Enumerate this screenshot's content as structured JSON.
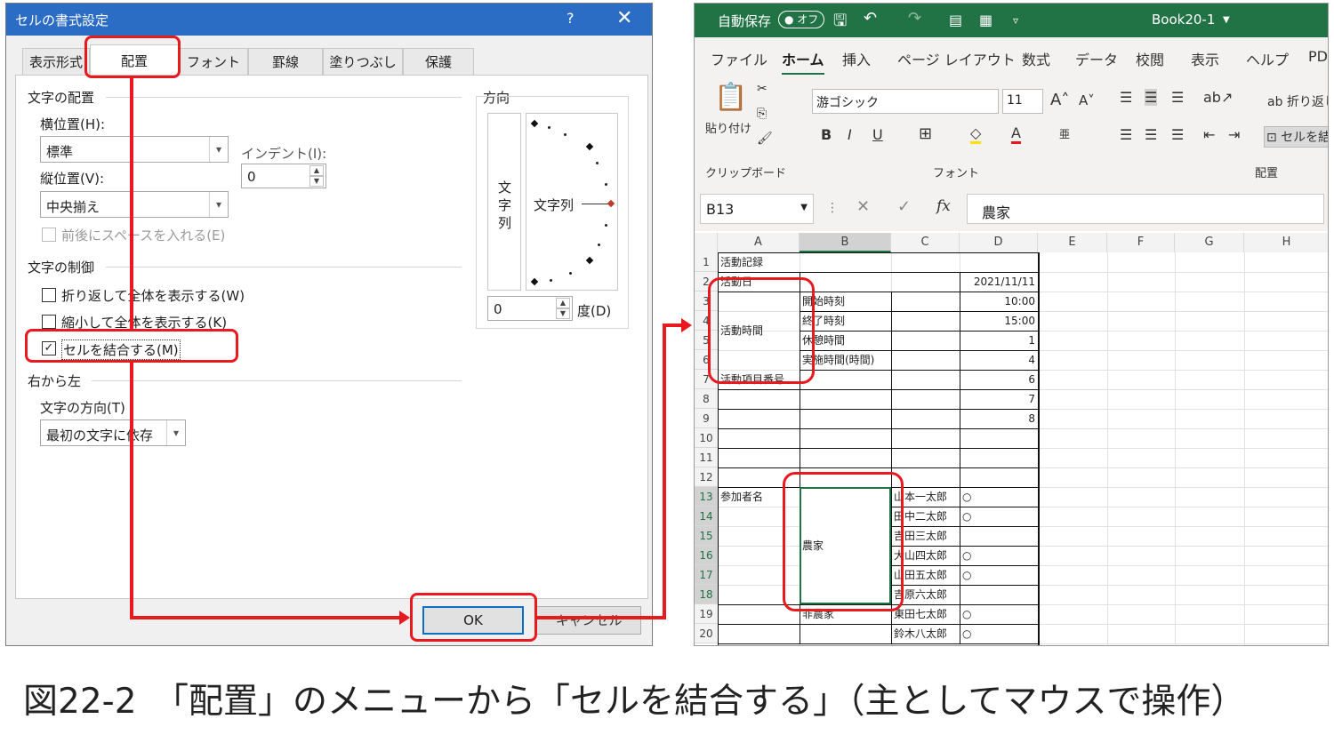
{
  "dialog": {
    "title": "セルの書式設定",
    "help": "?",
    "close": "✕",
    "tabs": [
      "表示形式",
      "配置",
      "フォント",
      "罫線",
      "塗りつぶし",
      "保護"
    ],
    "text_alignment_group": "文字の配置",
    "horizontal_label": "横位置(H):",
    "horizontal_value": "標準",
    "indent_label": "インデント(I):",
    "indent_value": "0",
    "vertical_label": "縦位置(V):",
    "vertical_value": "中央揃え",
    "justify_distributed": "前後にスペースを入れる(E)",
    "text_control_group": "文字の制御",
    "wrap_text": "折り返して全体を表示する(W)",
    "shrink_to_fit": "縮小して全体を表示する(K)",
    "merge_cells": "セルを結合する(M)",
    "merge_checked": "✓",
    "rtl_group": "右から左",
    "text_direction_label": "文字の方向(T)",
    "text_direction_value": "最初の文字に依存",
    "orientation_group": "方向",
    "vertical_text": [
      "文",
      "字",
      "列"
    ],
    "orientation_text": "文字列",
    "degree_value": "0",
    "degree_label": "度(D)",
    "ok_label": "OK",
    "cancel_label": "キャンセル"
  },
  "excel": {
    "autosave": "自動保存",
    "autosave_state": "オフ",
    "workbook": "Book20-1",
    "menu": [
      "ファイル",
      "ホーム",
      "挿入",
      "ページ レイアウト",
      "数式",
      "データ",
      "校閲",
      "表示",
      "ヘルプ",
      "PD"
    ],
    "ribbon": {
      "paste": "貼り付け",
      "clipboard_group": "クリップボード",
      "font_name": "游ゴシック",
      "font_size": "11",
      "font_group": "フォント",
      "wrap": "折り返し",
      "merge": "セルを結",
      "alignment_group": "配置",
      "bold": "B",
      "italic": "I",
      "underline": "U"
    },
    "name_box": "B13",
    "formula": "農家",
    "fx": "fx",
    "columns": [
      "A",
      "B",
      "C",
      "D",
      "E",
      "F",
      "G",
      "H"
    ],
    "rows": [
      "1",
      "2",
      "3",
      "4",
      "5",
      "6",
      "7",
      "8",
      "9",
      "10",
      "11",
      "12",
      "13",
      "14",
      "15",
      "16",
      "17",
      "18",
      "19",
      "20"
    ],
    "cells": {
      "a1": "活動記録",
      "a2": "活動日",
      "d2": "2021/11/11",
      "a3": "活動時間",
      "b3": "開始時刻",
      "d3": "10:00",
      "b4": "終了時刻",
      "d4": "15:00",
      "b5": "休憩時間",
      "d5": "1",
      "b6": "実施時間(時間)",
      "d6": "4",
      "a7": "活動項目番号",
      "d7": "6",
      "d8": "7",
      "d9": "8",
      "a13": "参加者名",
      "b15": "農家",
      "b19": "非農家",
      "c13": "山本一太郎",
      "c14": "田中二太郎",
      "c15": "吉田三太郎",
      "c16": "大山四太郎",
      "c17": "山田五太郎",
      "c18": "吉原六太郎",
      "c19": "東田七太郎",
      "c20": "鈴木八太郎",
      "d13": "○",
      "d14": "○",
      "d16": "○",
      "d17": "○",
      "d19": "○",
      "d20": "○"
    }
  },
  "caption": "図22-2　「配置」のメニューから「セルを結合する」（主としてマウスで操作）",
  "colors": {
    "accent_red": "#e8191f",
    "excel_green": "#217346",
    "dialog_blue": "#2b6cc4"
  }
}
